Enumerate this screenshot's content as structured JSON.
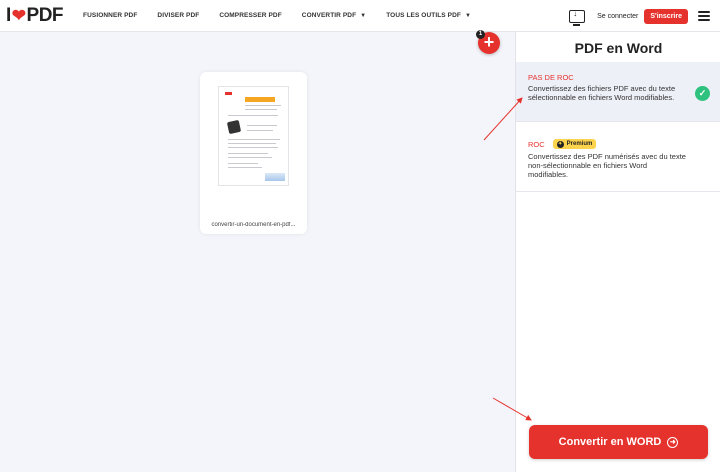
{
  "header": {
    "logo_left": "I",
    "logo_right": "PDF",
    "nav": [
      {
        "label": "FUSIONNER PDF",
        "has_caret": false
      },
      {
        "label": "DIVISER PDF",
        "has_caret": false
      },
      {
        "label": "COMPRESSER PDF",
        "has_caret": false
      },
      {
        "label": "CONVERTIR PDF",
        "has_caret": true
      },
      {
        "label": "TOUS LES OUTILS PDF",
        "has_caret": true
      }
    ],
    "login_label": "Se connecter",
    "signup_label": "S'inscrire"
  },
  "workspace": {
    "file_name": "convertir-un-document-en-pdf...",
    "file_count": "1",
    "add_symbol": "+"
  },
  "sidebar": {
    "title": "PDF en Word",
    "options": [
      {
        "title": "PAS DE ROC",
        "description": "Convertissez des fichiers PDF avec du texte sélectionnable en fichiers Word modifiables.",
        "selected": true
      },
      {
        "title": "ROC",
        "badge": "Premium",
        "description": "Convertissez des PDF numérisés avec du texte non-sélectionnable en fichiers Word modifiables.",
        "selected": false
      }
    ],
    "convert_label": "Convertir en WORD"
  },
  "colors": {
    "brand_red": "#e5322d",
    "premium_yellow": "#fcd34d",
    "check_green": "#2ec27e",
    "workspace_bg": "#f4f5fa"
  },
  "icons": {
    "logo_heart": "heart-icon",
    "desktop_app": "monitor-download-icon",
    "menu": "hamburger-menu-icon",
    "add": "plus-icon",
    "check": "check-icon",
    "premium": "premium-icon",
    "convert_arrow": "arrow-right-circle-icon"
  }
}
